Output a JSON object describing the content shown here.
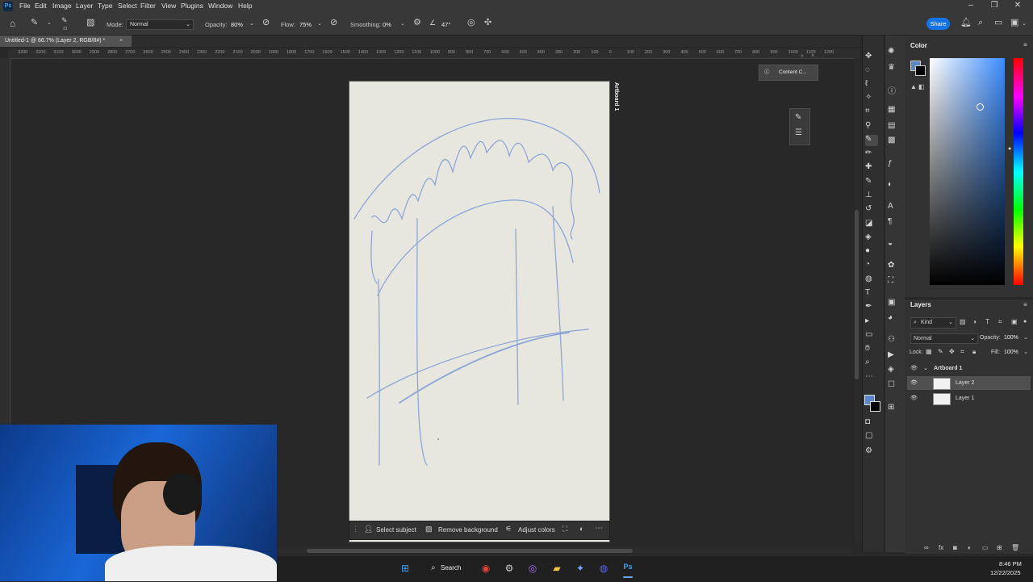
{
  "menubar": {
    "logo": "Ps",
    "items": [
      "File",
      "Edit",
      "Image",
      "Layer",
      "Type",
      "Select",
      "Filter",
      "View",
      "Plugins",
      "Window",
      "Help"
    ]
  },
  "options": {
    "brush_size": "21",
    "mode_label": "Mode:",
    "mode_value": "Normal",
    "opacity_label": "Opacity:",
    "opacity_value": "80%",
    "flow_label": "Flow:",
    "flow_value": "75%",
    "smoothing_label": "Smoothing:",
    "smoothing_value": "0%",
    "angle_value": "47°",
    "share_label": "Share"
  },
  "document": {
    "tab_title": "Untitled-1 @ 66.7% (Layer 2, RGB/8#) *",
    "artboard_label": "Artboard 1"
  },
  "ruler": {
    "labels": [
      "3300",
      "3200",
      "3100",
      "3000",
      "2900",
      "2800",
      "2700",
      "2600",
      "2500",
      "2400",
      "2300",
      "2200",
      "2100",
      "2000",
      "1900",
      "1800",
      "1700",
      "1600",
      "1500",
      "1400",
      "1300",
      "1200",
      "1100",
      "1000",
      "900",
      "800",
      "700",
      "600",
      "500",
      "400",
      "300",
      "200",
      "100",
      "0",
      "100",
      "200",
      "300",
      "400",
      "500",
      "600",
      "700",
      "800",
      "900",
      "1000",
      "1100",
      "1200"
    ]
  },
  "floating": {
    "content_credentials": "Content C..."
  },
  "context_bar": {
    "select_subject": "Select subject",
    "remove_background": "Remove background",
    "adjust_colors": "Adjust colors"
  },
  "color_panel": {
    "title": "Color",
    "foreground": "#5b87c9",
    "background": "#000000"
  },
  "layers_panel": {
    "title": "Layers",
    "kind_label": "Kind",
    "blend_mode": "Normal",
    "opacity_label": "Opacity:",
    "opacity_value": "100%",
    "lock_label": "Lock:",
    "fill_label": "Fill:",
    "fill_value": "100%",
    "artboard": "Artboard 1",
    "layers": [
      "Layer 2",
      "Layer 1"
    ],
    "selected": "Layer 2"
  },
  "taskbar": {
    "search_label": "Search",
    "time": "8:46 PM",
    "date": "12/22/2025"
  },
  "colors": {
    "accent": "#1473e6",
    "stroke": "#8ea6d6",
    "canvas": "#e8e7df"
  }
}
